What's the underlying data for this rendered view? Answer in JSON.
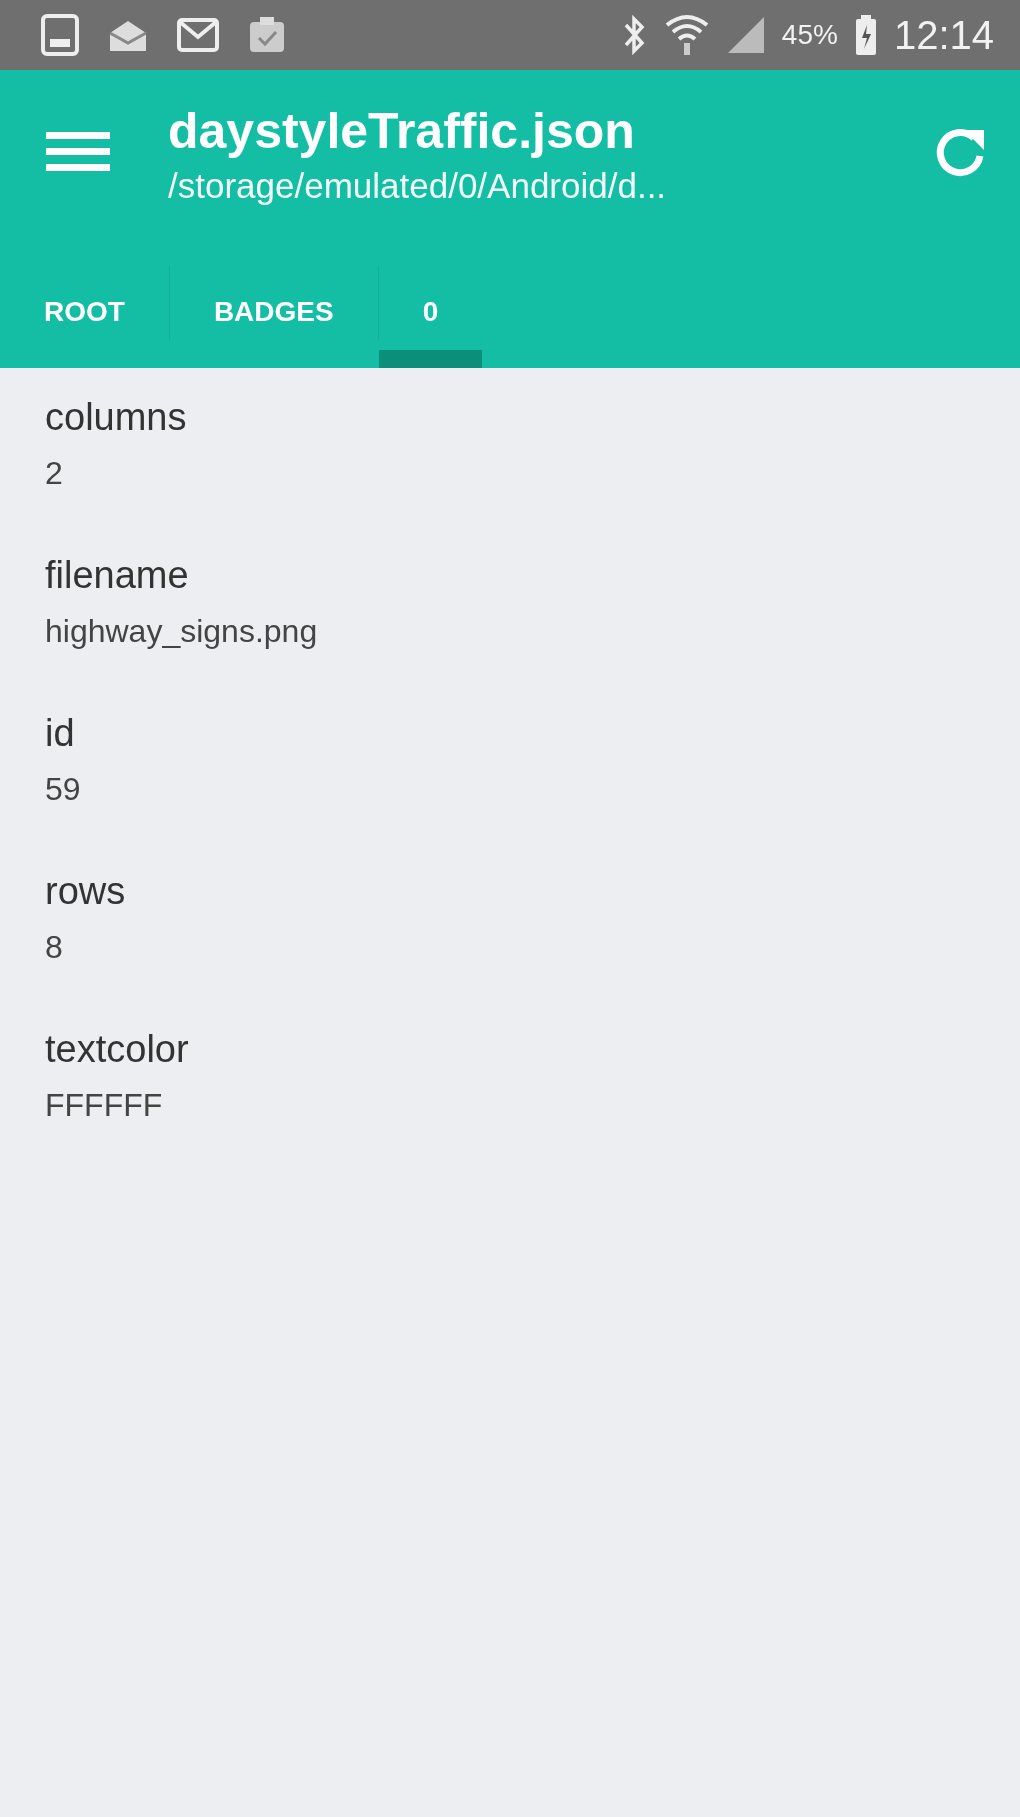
{
  "status_bar": {
    "battery": "45%",
    "time": "12:14"
  },
  "toolbar": {
    "title": "daystyleTraffic.json",
    "subtitle": "/storage/emulated/0/Android/d..."
  },
  "tabs": [
    {
      "label": "ROOT",
      "selected": false
    },
    {
      "label": "BADGES",
      "selected": false
    },
    {
      "label": "0",
      "selected": true
    }
  ],
  "fields": [
    {
      "key": "columns",
      "value": "2"
    },
    {
      "key": "filename",
      "value": "highway_signs.png"
    },
    {
      "key": "id",
      "value": "59"
    },
    {
      "key": "rows",
      "value": "8"
    },
    {
      "key": "textcolor",
      "value": "FFFFFF"
    }
  ]
}
